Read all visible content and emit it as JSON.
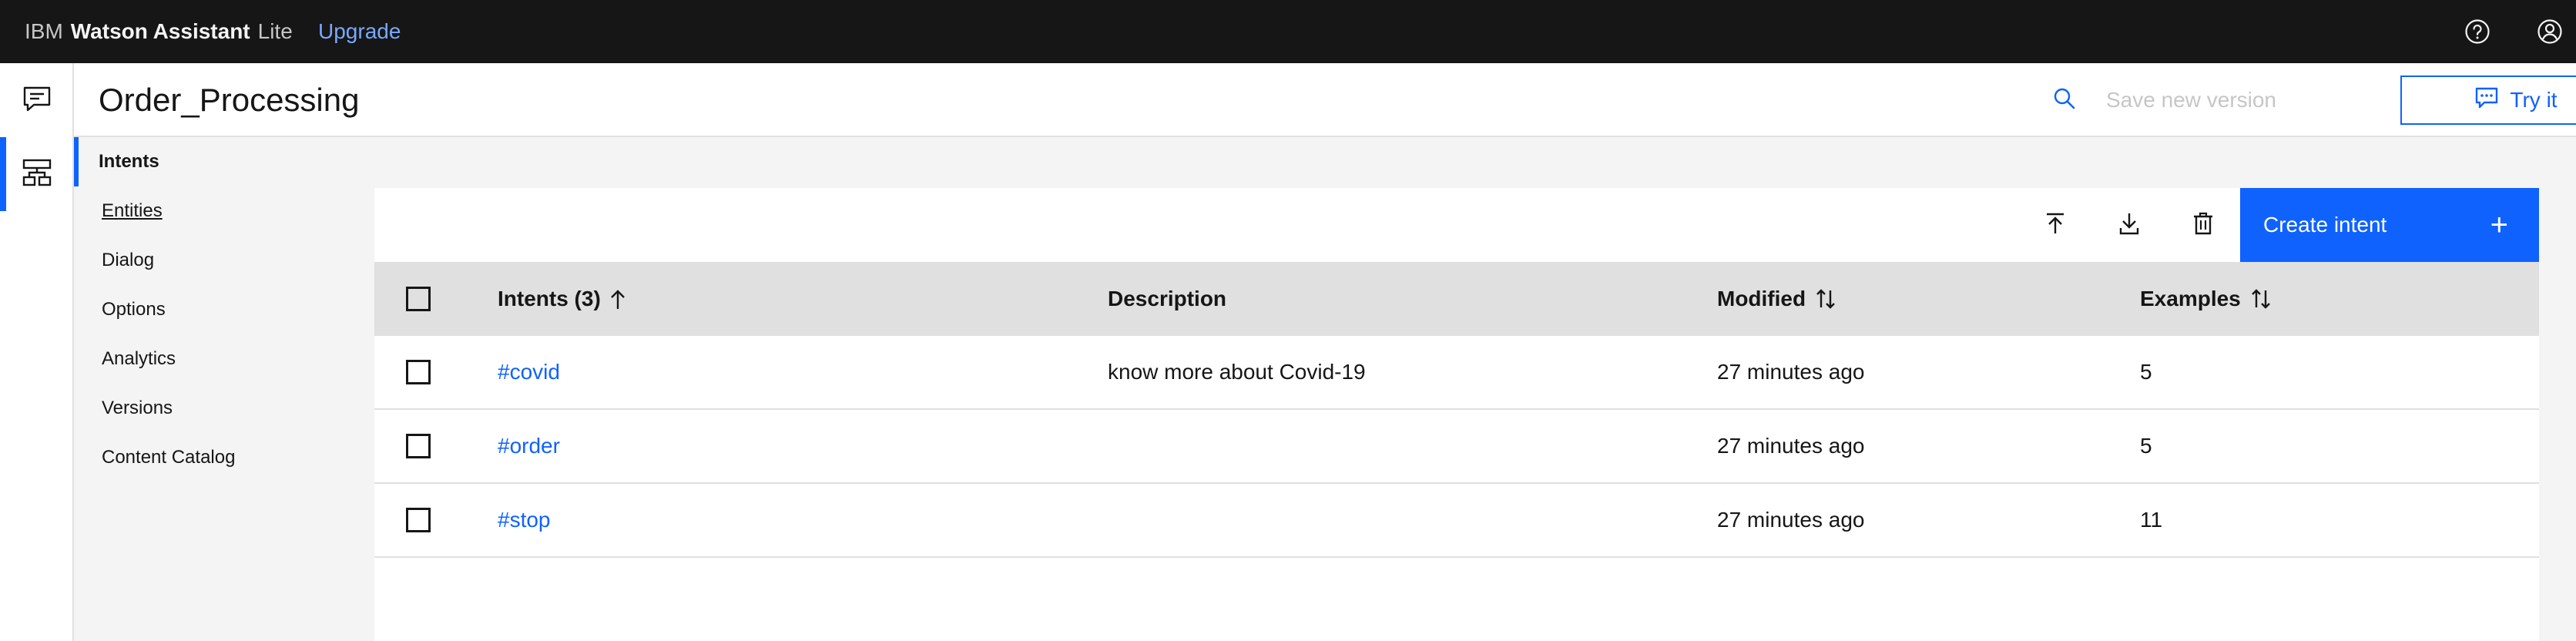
{
  "app": {
    "brand_ibm": "IBM",
    "brand_product": "Watson Assistant",
    "brand_plan": "Lite",
    "upgrade_label": "Upgrade"
  },
  "header": {
    "title": "Order_Processing",
    "save_version_label": "Save new version",
    "try_it_label": "Try it"
  },
  "subnav": {
    "items": [
      {
        "label": "Intents"
      },
      {
        "label": "Entities"
      },
      {
        "label": "Dialog"
      },
      {
        "label": "Options"
      },
      {
        "label": "Analytics"
      },
      {
        "label": "Versions"
      },
      {
        "label": "Content Catalog"
      }
    ]
  },
  "toolbar": {
    "create_label": "Create intent",
    "create_icon": "+"
  },
  "table": {
    "headers": {
      "intents": "Intents (3)",
      "description": "Description",
      "modified": "Modified",
      "examples": "Examples"
    },
    "rows": [
      {
        "intent": "#covid",
        "description": "know more about Covid-19",
        "modified": "27 minutes ago",
        "examples": "5"
      },
      {
        "intent": "#order",
        "description": "",
        "modified": "27 minutes ago",
        "examples": "5"
      },
      {
        "intent": "#stop",
        "description": "",
        "modified": "27 minutes ago",
        "examples": "11"
      }
    ]
  },
  "icons": {
    "help": "help-icon",
    "user": "user-avatar-icon",
    "rail_assistant": "chat-icon",
    "rail_skills": "skills-tree-icon",
    "search": "search-icon",
    "upload": "upload-icon",
    "download": "download-icon",
    "delete": "trash-icon"
  },
  "colors": {
    "accent": "#0f62fe",
    "topbar": "#161616",
    "link": "#0f62fe"
  }
}
